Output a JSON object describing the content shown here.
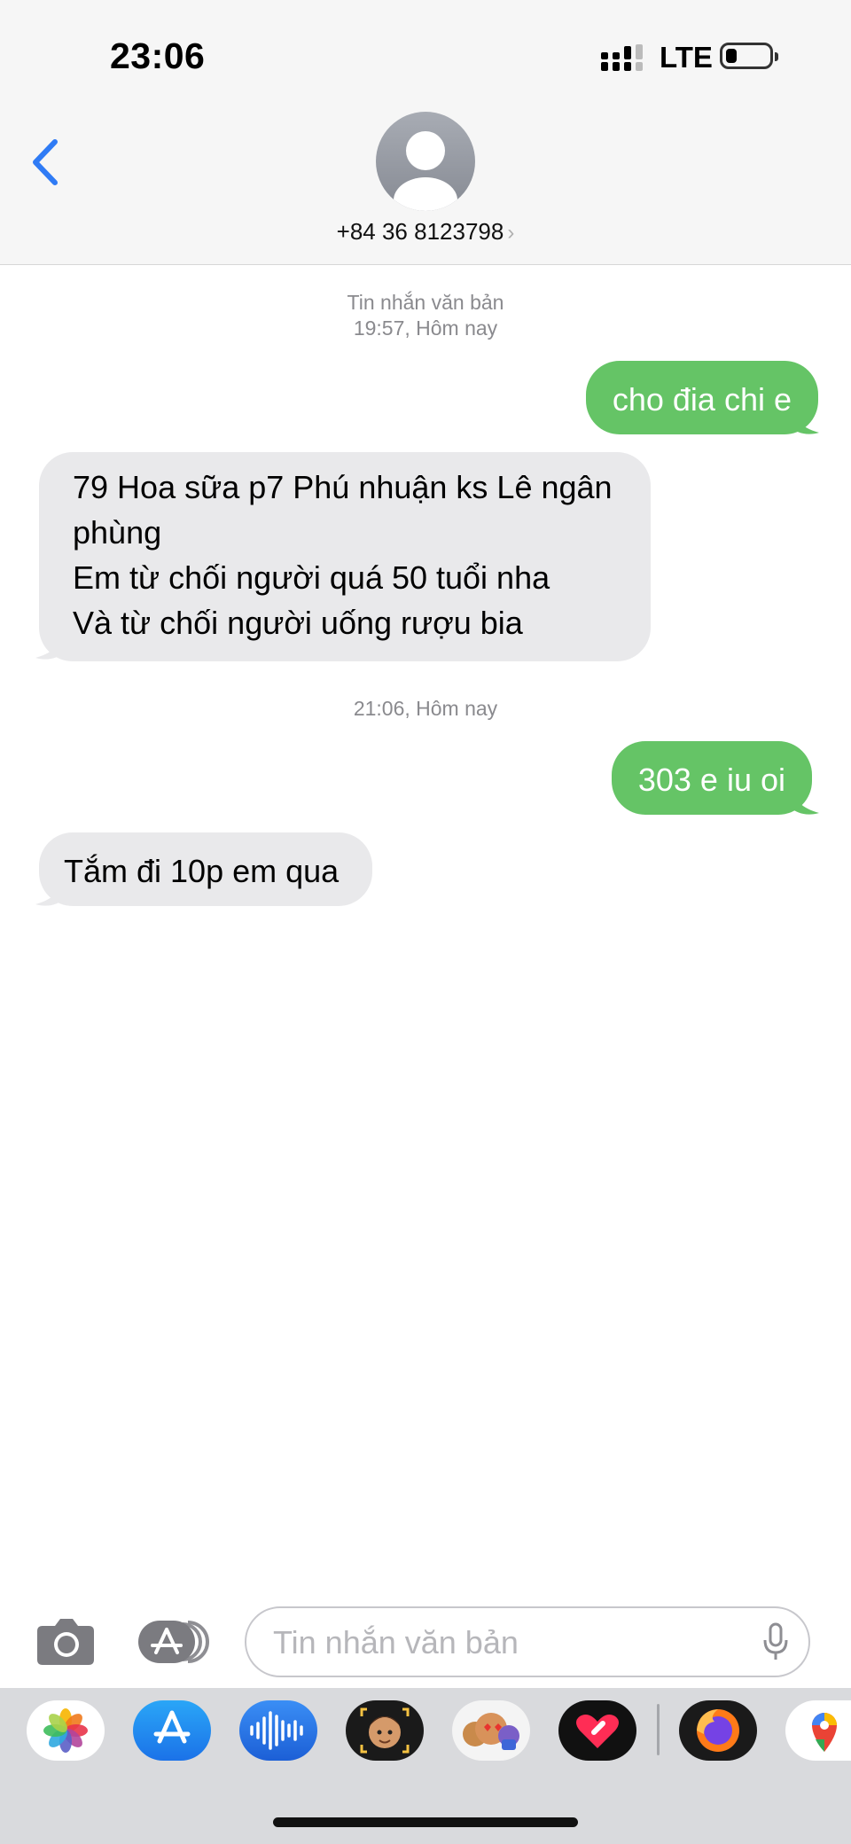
{
  "status_bar": {
    "time": "23:06",
    "network": "LTE"
  },
  "contact": {
    "name": "+84 36 8123798",
    "chevron": "›"
  },
  "messages_section": {
    "header_type": "Tin nhắn văn bản",
    "time1": "19:57, Hôm nay",
    "time2": "21:06, Hôm nay"
  },
  "messages": [
    {
      "direction": "outgoing",
      "text": "cho đia chi e"
    },
    {
      "direction": "incoming",
      "lines": [
        "79 Hoa sữa p7 Phú nhuận ks Lê ngân",
        "phùng",
        "Em từ chối người quá 50 tuổi nha",
        "Và từ chối người uống rượu bia"
      ]
    },
    {
      "direction": "outgoing",
      "text": "303 e iu oi"
    },
    {
      "direction": "incoming",
      "text": "Tắm đi 10p em qua"
    }
  ],
  "composer": {
    "placeholder": "Tin nhắn văn bản",
    "value": ""
  },
  "app_drawer": [
    "photos-icon",
    "app-store-icon",
    "audio-messages-icon",
    "memoji-icon",
    "animoji-icon",
    "digital-touch-icon",
    "firefox-icon",
    "google-maps-icon"
  ],
  "colors": {
    "outgoing_bubble": "#65c466",
    "incoming_bubble": "#e9e9eb",
    "accent": "#2f7bf5"
  }
}
